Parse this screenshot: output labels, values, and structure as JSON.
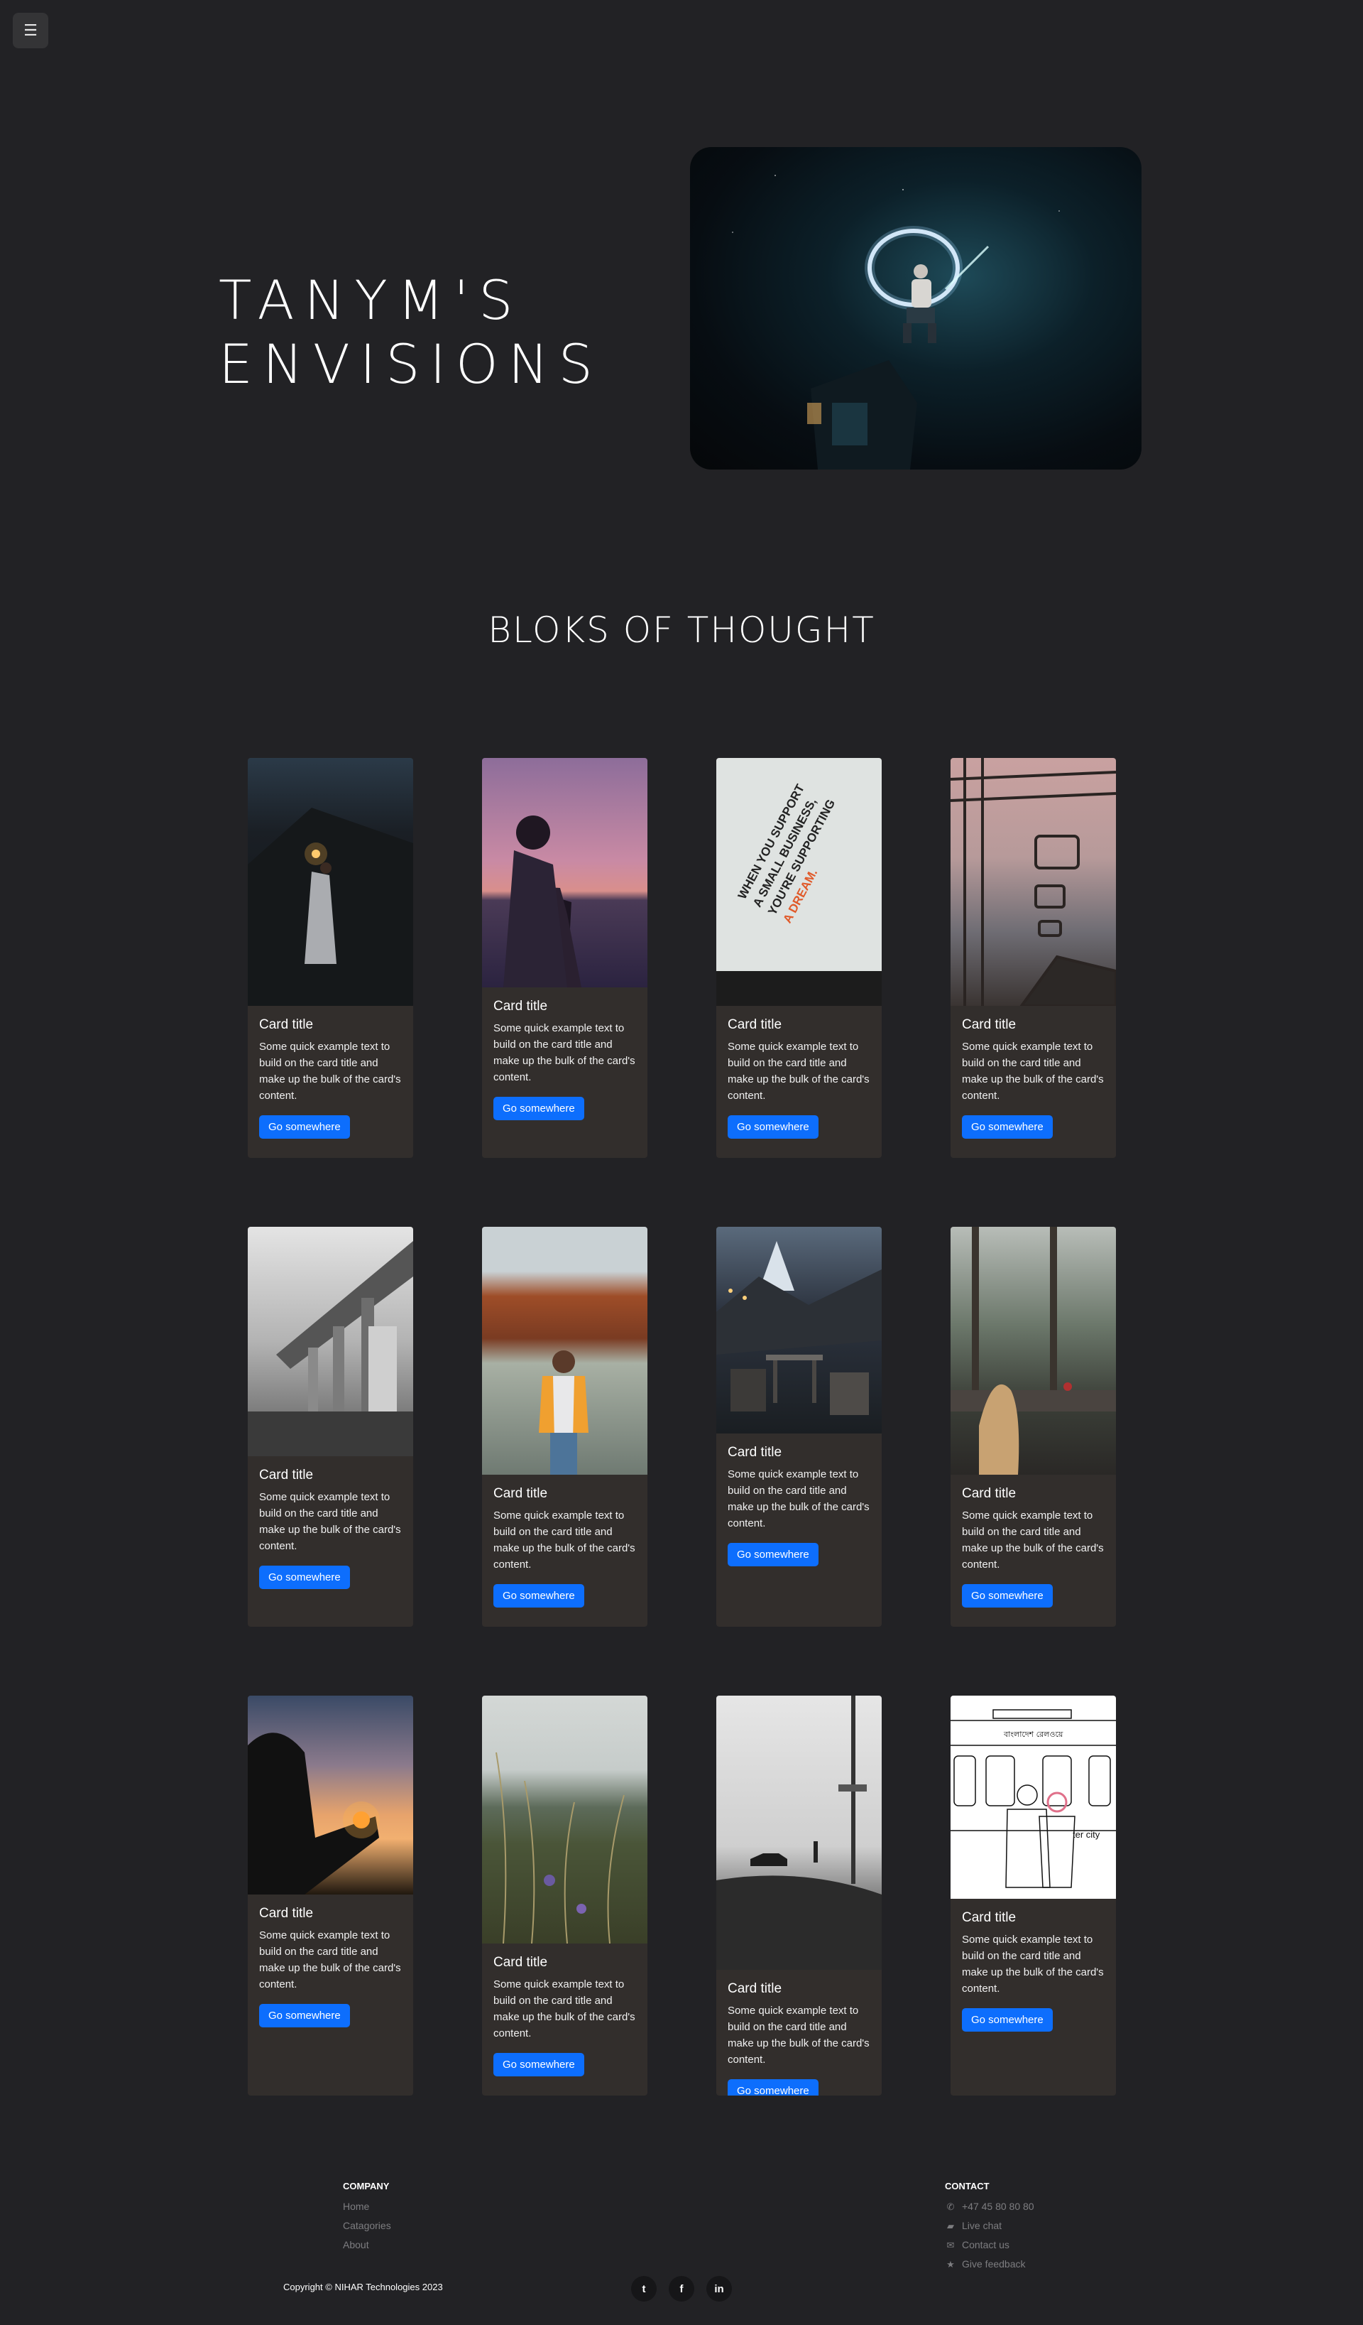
{
  "menu": {
    "icon": "hamburger-icon",
    "glyph": "☰"
  },
  "hero": {
    "title_line1": "TANYM'S",
    "title_line2": "ENVISIONS"
  },
  "section": {
    "title": "BLOKS OF THOUGHT"
  },
  "cards": [
    {
      "title": "Card title",
      "text": "Some quick example text to build on the card title and make up the bulk of the card's content.",
      "button": "Go somewhere"
    },
    {
      "title": "Card title",
      "text": "Some quick example text to build on the card title and make up the bulk of the card's content.",
      "button": "Go somewhere"
    },
    {
      "title": "Card title",
      "text": "Some quick example text to build on the card title and make up the bulk of the card's content.",
      "button": "Go somewhere"
    },
    {
      "title": "Card title",
      "text": "Some quick example text to build on the card title and make up the bulk of the card's content.",
      "button": "Go somewhere"
    },
    {
      "title": "Card title",
      "text": "Some quick example text to build on the card title and make up the bulk of the card's content.",
      "button": "Go somewhere"
    },
    {
      "title": "Card title",
      "text": "Some quick example text to build on the card title and make up the bulk of the card's content.",
      "button": "Go somewhere"
    },
    {
      "title": "Card title",
      "text": "Some quick example text to build on the card title and make up the bulk of the card's content.",
      "button": "Go somewhere"
    },
    {
      "title": "Card title",
      "text": "Some quick example text to build on the card title and make up the bulk of the card's content.",
      "button": "Go somewhere"
    },
    {
      "title": "Card title",
      "text": "Some quick example text to build on the card title and make up the bulk of the card's content.",
      "button": "Go somewhere"
    },
    {
      "title": "Card title",
      "text": "Some quick example text to build on the card title and make up the bulk of the card's content.",
      "button": "Go somewhere"
    },
    {
      "title": "Card title",
      "text": "Some quick example text to build on the card title and make up the bulk of the card's content.",
      "button": "Go somewhere"
    },
    {
      "title": "Card title",
      "text": "Some quick example text to build on the card title and make up the bulk of the card's content.",
      "button": "Go somewhere"
    }
  ],
  "card_image_text": {
    "small_business": [
      "WHEN YOU SUPPORT",
      "A SMALL BUSINESS,",
      "YOU'RE SUPPORTING",
      "A DREAM."
    ],
    "poster_header": "বাংলাদেশ রেলওয়ে",
    "poster_side": "ter city"
  },
  "footer": {
    "company": {
      "heading": "COMPANY",
      "links": [
        "Home",
        "Catagories",
        "About"
      ]
    },
    "contact": {
      "heading": "CONTACT",
      "items": [
        {
          "icon": "phone-icon",
          "label": "+47 45 80 80 80"
        },
        {
          "icon": "chat-icon",
          "label": "Live chat"
        },
        {
          "icon": "envelope-icon",
          "label": "Contact us"
        },
        {
          "icon": "star-icon",
          "label": "Give feedback"
        }
      ]
    },
    "copyright": "Copyright © NIHAR Technologies 2023",
    "social": [
      {
        "icon": "twitter-icon",
        "glyph": "t"
      },
      {
        "icon": "facebook-icon",
        "glyph": "f"
      },
      {
        "icon": "linkedin-icon",
        "glyph": "in"
      }
    ]
  },
  "colors": {
    "background": "#222225",
    "card": "#322e2c",
    "button": "#0d6efd",
    "muted_text": "#7d7d80"
  }
}
